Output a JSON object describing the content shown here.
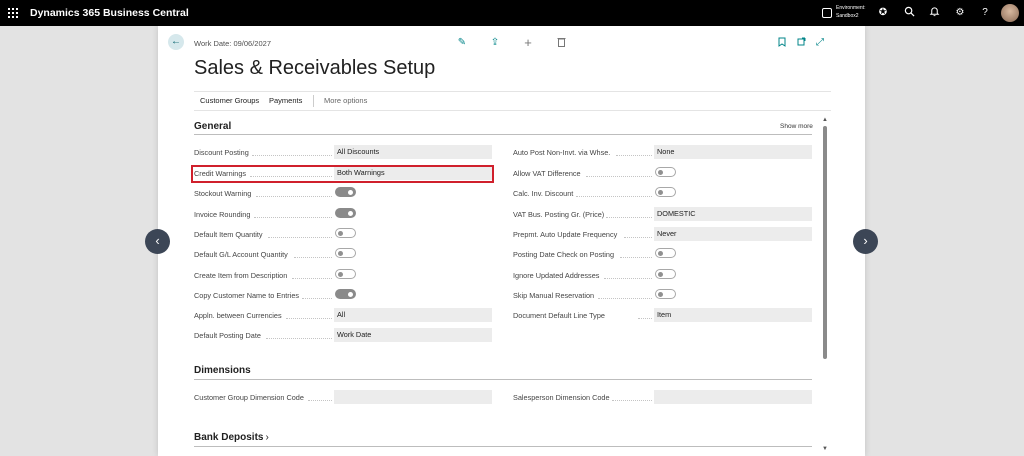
{
  "app": {
    "name": "Dynamics 365 Business Central",
    "environment_line1": "Environment:",
    "environment_line2": "Sandbox2"
  },
  "page": {
    "work_date": "Work Date: 09/06/2027",
    "title": "Sales & Receivables Setup"
  },
  "actions": {
    "customer_groups": "Customer Groups",
    "payments": "Payments",
    "more_options": "More options"
  },
  "general": {
    "heading": "General",
    "show_more": "Show more",
    "left": [
      {
        "label": "Discount Posting",
        "value": "All Discounts"
      },
      {
        "label": "Credit Warnings",
        "value": "Both Warnings"
      },
      {
        "label": "Stockout Warning",
        "toggle": true
      },
      {
        "label": "Invoice Rounding",
        "toggle": true
      },
      {
        "label": "Default Item Quantity",
        "toggle": false
      },
      {
        "label": "Default G/L Account Quantity",
        "toggle": false
      },
      {
        "label": "Create Item from Description",
        "toggle": false
      },
      {
        "label": "Copy Customer Name to Entries",
        "toggle": true
      },
      {
        "label": "Appln. between Currencies",
        "value": "All"
      },
      {
        "label": "Default Posting Date",
        "value": "Work Date"
      }
    ],
    "right": [
      {
        "label": "Auto Post Non-Invt. via Whse.",
        "value": "None"
      },
      {
        "label": "Allow VAT Difference",
        "toggle": false
      },
      {
        "label": "Calc. Inv. Discount",
        "toggle": false
      },
      {
        "label": "VAT Bus. Posting Gr. (Price)",
        "value": "DOMESTIC"
      },
      {
        "label": "Prepmt. Auto Update Frequency",
        "value": "Never"
      },
      {
        "label": "Posting Date Check on Posting",
        "toggle": false
      },
      {
        "label": "Ignore Updated Addresses",
        "toggle": false
      },
      {
        "label": "Skip Manual Reservation",
        "toggle": false
      },
      {
        "label": "Document Default Line Type",
        "value": "Item"
      }
    ]
  },
  "dimensions": {
    "heading": "Dimensions",
    "customer_group_label": "Customer Group Dimension Code",
    "customer_group_value": "",
    "salesperson_label": "Salesperson Dimension Code",
    "salesperson_value": ""
  },
  "bank_deposits": {
    "heading": "Bank Deposits"
  },
  "icons": [
    "waffle-icon",
    "environment-icon",
    "copilot-icon",
    "search-icon",
    "bell-icon",
    "gear-icon",
    "help-icon",
    "back-arrow-icon",
    "edit-icon",
    "share-icon",
    "add-icon",
    "delete-icon",
    "bookmark-icon",
    "open-new-window-icon",
    "expand-icon",
    "chevron-left-icon",
    "chevron-right-icon"
  ],
  "colors": {
    "accent": "#008488",
    "highlight": "#d0202c",
    "topbar": "#000000"
  }
}
